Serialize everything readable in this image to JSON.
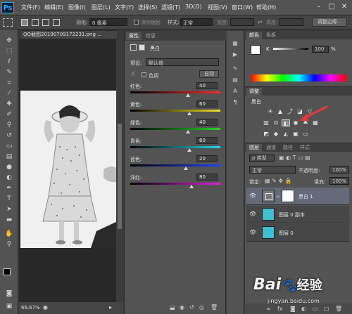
{
  "app": {
    "logo": "Ps"
  },
  "menu": [
    "文件(F)",
    "编辑(E)",
    "图像(I)",
    "图层(L)",
    "文字(Y)",
    "选择(S)",
    "滤镜(T)",
    "3D(D)",
    "视图(V)",
    "窗口(W)",
    "帮助(H)"
  ],
  "window_controls": [
    "–",
    "□",
    "✕"
  ],
  "options_bar": {
    "feather_label": "羽化:",
    "feather_value": "0 像素",
    "antialias_label": "消除锯齿",
    "style_label": "样式:",
    "style_value": "正常",
    "width_label": "宽度:",
    "height_label": "高度:",
    "refine_button": "调整边缘..."
  },
  "document": {
    "tab_title": "QQ截图20190709172231.png ...",
    "zoom": "66.67%"
  },
  "properties": {
    "tabs": [
      "属性",
      "信息"
    ],
    "adjustment_name": "黑白",
    "preset_label": "预设:",
    "preset_value": "默认值",
    "tint_label": "色调",
    "auto_button": "自动",
    "sliders": [
      {
        "label": "红色:",
        "value": "40",
        "position": 0.64
      },
      {
        "label": "黄色:",
        "value": "60",
        "position": 0.66
      },
      {
        "label": "绿色:",
        "value": "40",
        "position": 0.64
      },
      {
        "label": "青色:",
        "value": "60",
        "position": 0.66
      },
      {
        "label": "蓝色:",
        "value": "20",
        "position": 0.62
      },
      {
        "label": "洋红:",
        "value": "80",
        "position": 0.68
      }
    ]
  },
  "color_panel": {
    "tabs": [
      "颜色",
      "色板"
    ],
    "channel": "K",
    "value": "100",
    "unit": "%"
  },
  "adjustments_panel": {
    "tab": "调整",
    "title": "黑白"
  },
  "layers_panel": {
    "tabs": [
      "图层",
      "通道",
      "路径",
      "样式"
    ],
    "kind": "p 类型",
    "blend_mode": "正常",
    "opacity_label": "不透明度:",
    "opacity_value": "100%",
    "lock_label": "锁定:",
    "fill_label": "填充:",
    "fill_value": "100%",
    "layers": [
      {
        "name": "黑白 1",
        "selected": true
      },
      {
        "name": "图层 0 副本",
        "selected": false
      },
      {
        "name": "图层 0",
        "selected": false
      }
    ]
  },
  "watermark": {
    "brand": "Bai",
    "brand2": "经验",
    "url": "jingyan.baidu.com"
  },
  "colors": {
    "accent": "#31a8ff",
    "arrow": "#e53935"
  }
}
